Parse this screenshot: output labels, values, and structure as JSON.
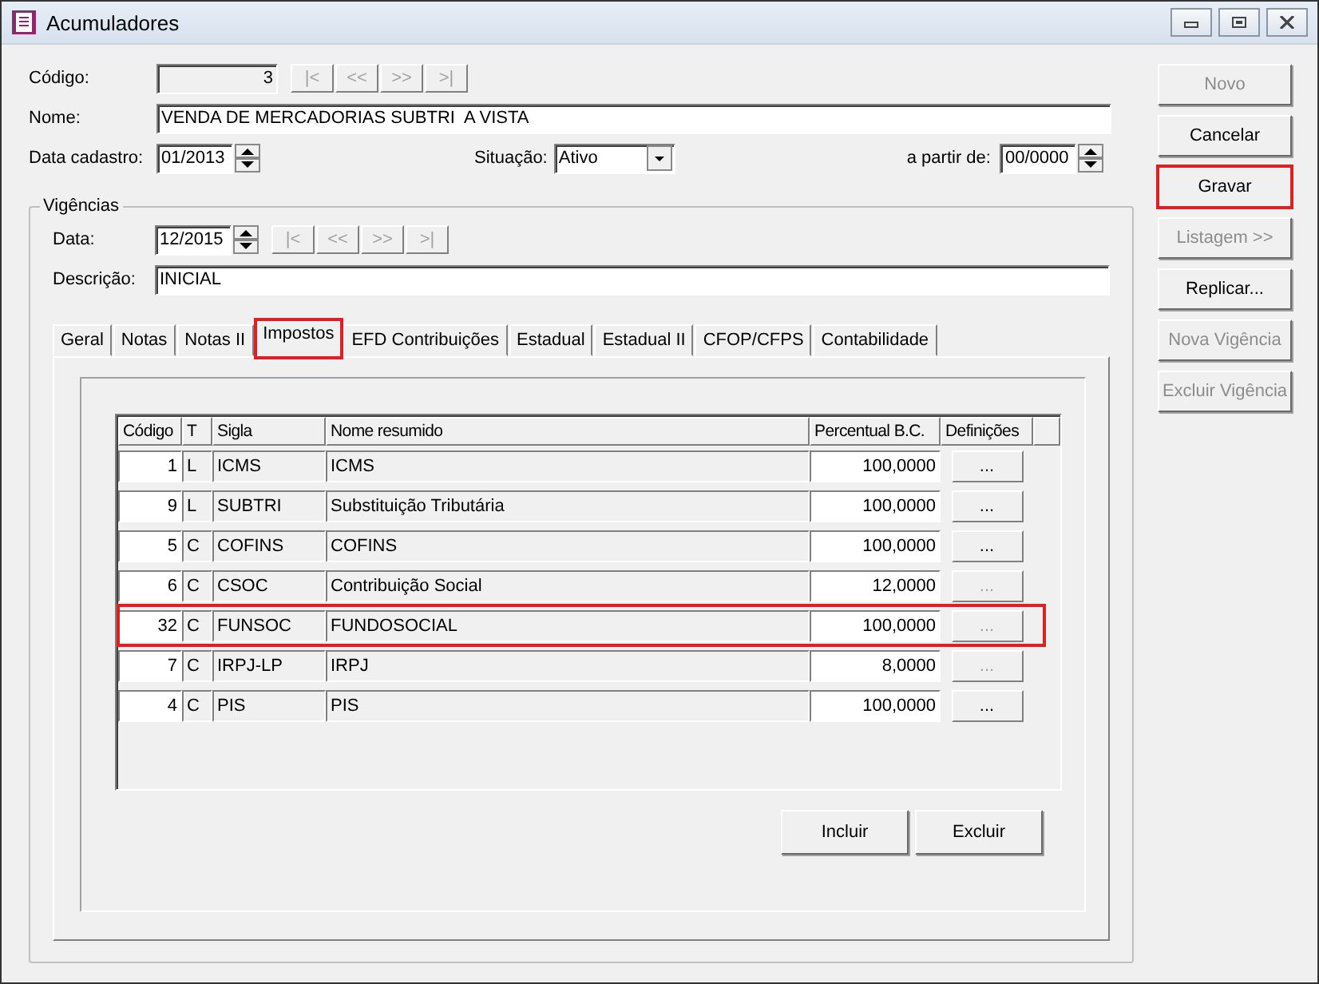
{
  "window": {
    "title": "Acumuladores"
  },
  "form": {
    "codigo": {
      "label": "Código:",
      "value": "3"
    },
    "record_nav": [
      {
        "label": "|<",
        "disabled": true
      },
      {
        "label": "<<",
        "disabled": true
      },
      {
        "label": ">>",
        "disabled": true
      },
      {
        "label": ">|",
        "disabled": true
      }
    ],
    "nome": {
      "label": "Nome:",
      "value": "VENDA DE MERCADORIAS SUBTRI  A VISTA"
    },
    "data_cadastro": {
      "label": "Data cadastro:",
      "value": "01/2013"
    },
    "situacao": {
      "label": "Situação:",
      "value": "Ativo"
    },
    "a_partir_de": {
      "label": "a partir de:",
      "value": "00/0000"
    }
  },
  "vigencias": {
    "title": "Vigências",
    "data": {
      "label": "Data:",
      "value": "12/2015"
    },
    "nav": [
      {
        "label": "|<",
        "disabled": true
      },
      {
        "label": "<<",
        "disabled": true
      },
      {
        "label": ">>",
        "disabled": true
      },
      {
        "label": ">|",
        "disabled": true
      }
    ],
    "descricao": {
      "label": "Descrição:",
      "value": "INICIAL"
    }
  },
  "tabs": [
    {
      "label": "Geral",
      "selected": false,
      "highlighted": false
    },
    {
      "label": "Notas",
      "selected": false,
      "highlighted": false
    },
    {
      "label": "Notas II",
      "selected": false,
      "highlighted": false
    },
    {
      "label": "Impostos",
      "selected": true,
      "highlighted": true
    },
    {
      "label": "EFD Contribuições",
      "selected": false,
      "highlighted": false
    },
    {
      "label": "Estadual",
      "selected": false,
      "highlighted": false
    },
    {
      "label": "Estadual II",
      "selected": false,
      "highlighted": false
    },
    {
      "label": "CFOP/CFPS",
      "selected": false,
      "highlighted": false
    },
    {
      "label": "Contabilidade",
      "selected": false,
      "highlighted": false
    }
  ],
  "table": {
    "columns": [
      "Código",
      "T",
      "Sigla",
      "Nome resumido",
      "Percentual B.C.",
      "Definições"
    ],
    "rows": [
      {
        "codigo": "1",
        "t": "L",
        "sigla": "ICMS",
        "nome": "ICMS",
        "percentual": "100,0000",
        "definicoes": "...",
        "definicoes_disabled": false,
        "highlighted": false
      },
      {
        "codigo": "9",
        "t": "L",
        "sigla": "SUBTRI",
        "nome": "Substituição Tributária",
        "percentual": "100,0000",
        "definicoes": "...",
        "definicoes_disabled": false,
        "highlighted": false
      },
      {
        "codigo": "5",
        "t": "C",
        "sigla": "COFINS",
        "nome": "COFINS",
        "percentual": "100,0000",
        "definicoes": "...",
        "definicoes_disabled": false,
        "highlighted": false
      },
      {
        "codigo": "6",
        "t": "C",
        "sigla": "CSOC",
        "nome": "Contribuição Social",
        "percentual": "12,0000",
        "definicoes": "...",
        "definicoes_disabled": true,
        "highlighted": false
      },
      {
        "codigo": "32",
        "t": "C",
        "sigla": "FUNSOC",
        "nome": "FUNDOSOCIAL",
        "percentual": "100,0000",
        "definicoes": "...",
        "definicoes_disabled": true,
        "highlighted": true
      },
      {
        "codigo": "7",
        "t": "C",
        "sigla": "IRPJ-LP",
        "nome": "IRPJ",
        "percentual": "8,0000",
        "definicoes": "...",
        "definicoes_disabled": true,
        "highlighted": false
      },
      {
        "codigo": "4",
        "t": "C",
        "sigla": "PIS",
        "nome": "PIS",
        "percentual": "100,0000",
        "definicoes": "...",
        "definicoes_disabled": false,
        "highlighted": false
      }
    ]
  },
  "table_buttons": [
    {
      "label": "Incluir"
    },
    {
      "label": "Excluir"
    }
  ],
  "side_buttons": [
    {
      "label": "Novo",
      "disabled": true,
      "highlighted": false
    },
    {
      "label": "Cancelar",
      "disabled": false,
      "highlighted": false
    },
    {
      "label": "Gravar",
      "disabled": false,
      "highlighted": true
    },
    {
      "label": "Listagem >>",
      "disabled": true,
      "highlighted": false
    },
    {
      "label": "Replicar...",
      "disabled": false,
      "highlighted": false
    },
    {
      "label": "Nova Vigência",
      "disabled": true,
      "highlighted": false
    },
    {
      "label": "Excluir Vigência",
      "disabled": true,
      "highlighted": false
    }
  ]
}
